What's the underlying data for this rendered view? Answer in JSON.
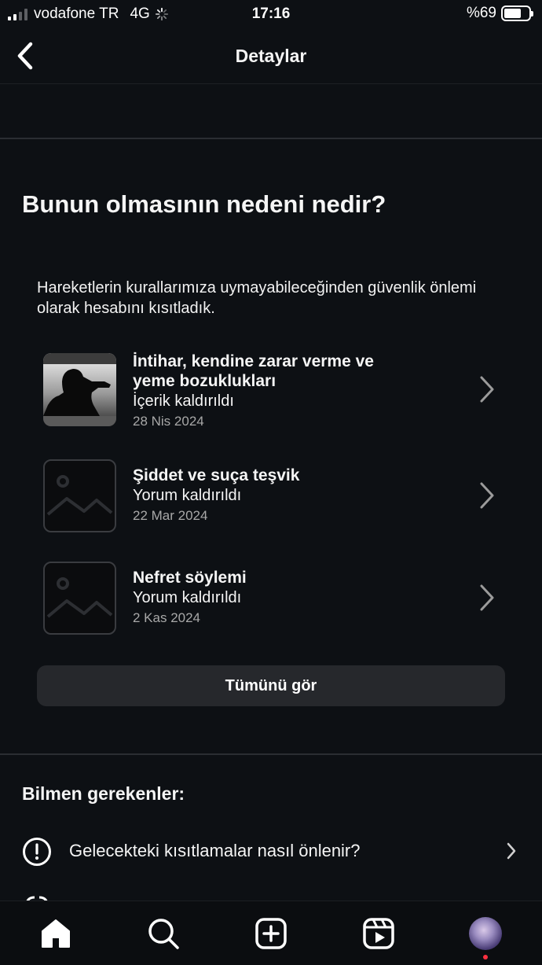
{
  "status_bar": {
    "carrier": "vodafone TR",
    "network": "4G",
    "time": "17:16",
    "battery_text": "%69",
    "battery_level": 0.69
  },
  "nav": {
    "title": "Detaylar",
    "back_icon": "chevron-left-icon"
  },
  "reason_section": {
    "title": "Bunun olmasının nedeni nedir?",
    "intro": "Hareketlerin kurallarımıza uymayabileceğinden güvenlik önlemi olarak hesabını kısıtladık.",
    "items": [
      {
        "title_line1": "İntihar, kendine zarar verme ve",
        "title_line2": "yeme bozuklukları",
        "type": "İçerik kaldırıldı",
        "date": "28 Nis 2024",
        "thumb": "silhouette-photo"
      },
      {
        "title_line1": "Şiddet ve suça teşvik",
        "title_line2": "",
        "type": "Yorum kaldırıldı",
        "date": "22 Mar 2024",
        "thumb": "image-placeholder-icon"
      },
      {
        "title_line1": "Nefret söylemi",
        "title_line2": "",
        "type": "Yorum kaldırıldı",
        "date": "2 Kas 2024",
        "thumb": "image-placeholder-icon"
      }
    ],
    "see_all_label": "Tümünü gör"
  },
  "know_section": {
    "title": "Bilmen gerekenler:",
    "rows": [
      {
        "icon": "alert-circle-icon",
        "label": "Gelecekteki kısıtlamalar nasıl önlenir?"
      }
    ]
  },
  "tab_bar": {
    "tabs": [
      "home-icon",
      "search-icon",
      "create-icon",
      "reels-icon",
      "profile-avatar"
    ]
  },
  "colors": {
    "background": "#0d1014",
    "button": "#26282c",
    "secondary_text": "#a8a8a8",
    "notification_dot": "#ff3040"
  }
}
